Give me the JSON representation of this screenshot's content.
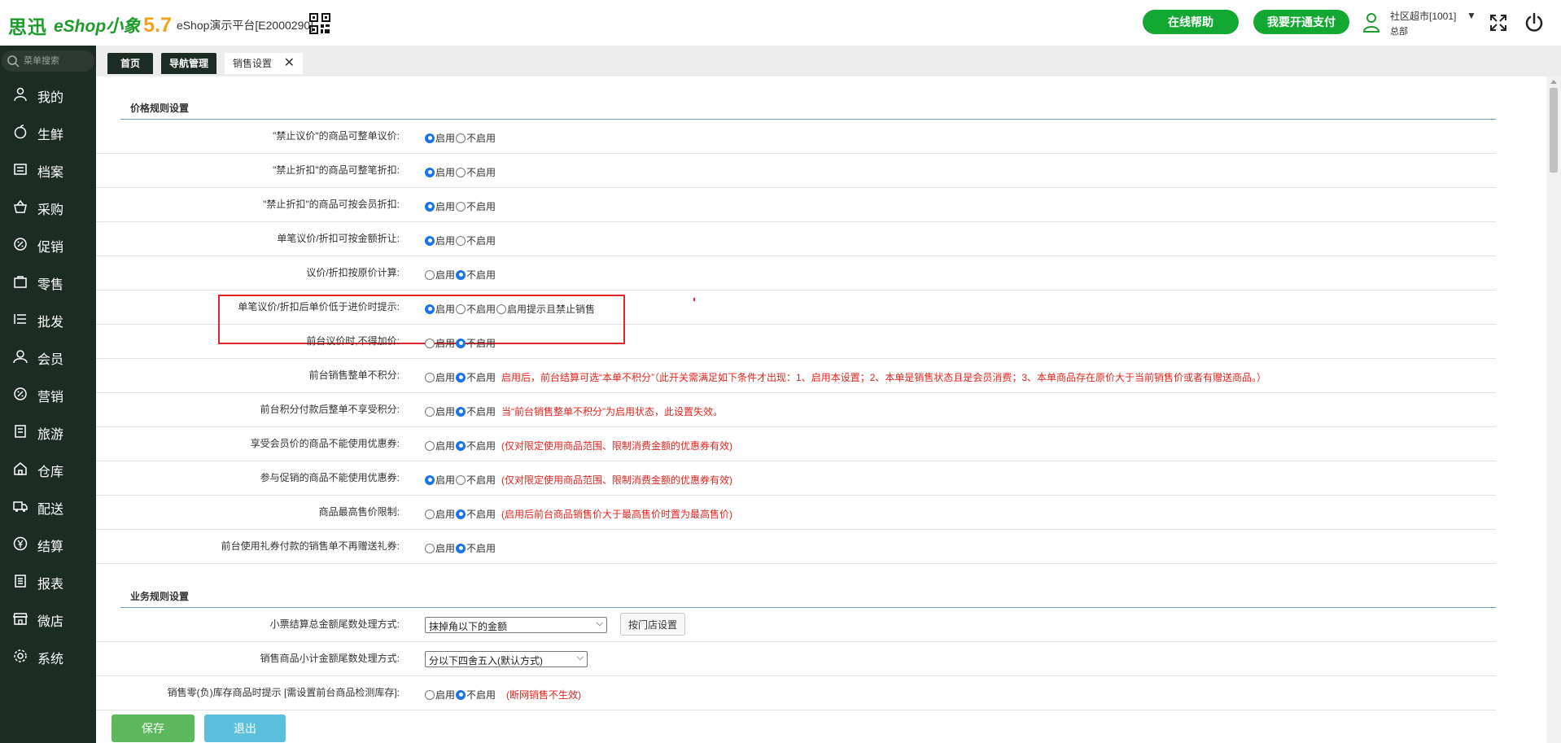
{
  "header": {
    "brand_name": "思迅",
    "brand_eshop": "eShop小象",
    "brand_version": "5.7",
    "platform_label": "eShop演示平台[E2000290]",
    "help_button": "在线帮助",
    "pay_button": "我要开通支付",
    "user_store": "社区超市[1001]",
    "user_dept": "总部",
    "user_caret": "▼"
  },
  "sidebar": {
    "search_placeholder": "菜单搜索",
    "items": [
      {
        "label": "我的",
        "icon": "user-icon"
      },
      {
        "label": "生鲜",
        "icon": "apple-icon"
      },
      {
        "label": "档案",
        "icon": "folder-icon"
      },
      {
        "label": "采购",
        "icon": "basket-icon"
      },
      {
        "label": "促销",
        "icon": "promotion-icon"
      },
      {
        "label": "零售",
        "icon": "bag-icon"
      },
      {
        "label": "批发",
        "icon": "list-icon"
      },
      {
        "label": "会员",
        "icon": "member-icon"
      },
      {
        "label": "营销",
        "icon": "marketing-icon"
      },
      {
        "label": "旅游",
        "icon": "document-icon"
      },
      {
        "label": "仓库",
        "icon": "warehouse-icon"
      },
      {
        "label": "配送",
        "icon": "truck-icon"
      },
      {
        "label": "结算",
        "icon": "yen-icon"
      },
      {
        "label": "报表",
        "icon": "report-icon"
      },
      {
        "label": "微店",
        "icon": "shop-icon"
      },
      {
        "label": "系统",
        "icon": "gear-icon"
      }
    ]
  },
  "tabs": [
    {
      "label": "首页"
    },
    {
      "label": "导航管理"
    },
    {
      "label": "销售设置",
      "close": "✕"
    }
  ],
  "options": {
    "on": "启用",
    "off": "不启用",
    "on_forbid": "启用提示且禁止销售"
  },
  "price_section": {
    "title": "价格规则设置",
    "rows": [
      {
        "label": "\"禁止议价\"的商品可整单议价:",
        "selected": "on"
      },
      {
        "label": "\"禁止折扣\"的商品可整笔折扣:",
        "selected": "on"
      },
      {
        "label": "\"禁止折扣\"的商品可按会员折扣:",
        "selected": "on"
      },
      {
        "label": "单笔议价/折扣可按金额折让:",
        "selected": "on"
      },
      {
        "label": "议价/折扣按原价计算:",
        "selected": "off"
      },
      {
        "label": "单笔议价/折扣后单价低于进价时提示:",
        "selected": "on"
      },
      {
        "label": "前台议价时,不得加价:",
        "selected": "off"
      },
      {
        "label": "前台销售整单不积分:",
        "selected": "off",
        "note": "启用后，前台结算可选“本单不积分”（此开关需满足如下条件才出现：1、启用本设置；2、本单是销售状态且是会员消费；3、本单商品存在原价大于当前销售价或者有赠送商品。）"
      },
      {
        "label": "前台积分付款后整单不享受积分:",
        "selected": "off",
        "note": "当“前台销售整单不积分”为启用状态，此设置失效。"
      },
      {
        "label": "享受会员价的商品不能使用优惠券:",
        "selected": "off",
        "note": "(仅对限定使用商品范围、限制消费金额的优惠券有效)"
      },
      {
        "label": "参与促销的商品不能使用优惠券:",
        "selected": "on",
        "note": "(仅对限定使用商品范围、限制消费金额的优惠券有效)"
      },
      {
        "label": "商品最高售价限制:",
        "selected": "off",
        "note": "(启用后前台商品销售价大于最高售价时置为最高售价)"
      },
      {
        "label": "前台使用礼券付款的销售单不再赠送礼券:",
        "selected": "off"
      }
    ]
  },
  "business_section": {
    "title": "业务规则设置",
    "rows": [
      {
        "label": "小票结算总金额尾数处理方式:",
        "select_value": "抹掉角以下的金额",
        "button": "按门店设置"
      },
      {
        "label": "销售商品小计金额尾数处理方式:",
        "select_value": "分以下四舍五入(默认方式)"
      },
      {
        "label": "销售零(负)库存商品时提示 [需设置前台商品检测库存]:",
        "selected": "off",
        "note": "(断网销售不生效)"
      }
    ]
  },
  "footer": {
    "save": "保存",
    "exit": "退出"
  },
  "colors": {
    "brand_green": "#1d9c2b",
    "sidebar_bg": "#1c2b23",
    "note_red": "#e5231d",
    "save_green": "#5cb85c",
    "exit_blue": "#5bc0de"
  }
}
